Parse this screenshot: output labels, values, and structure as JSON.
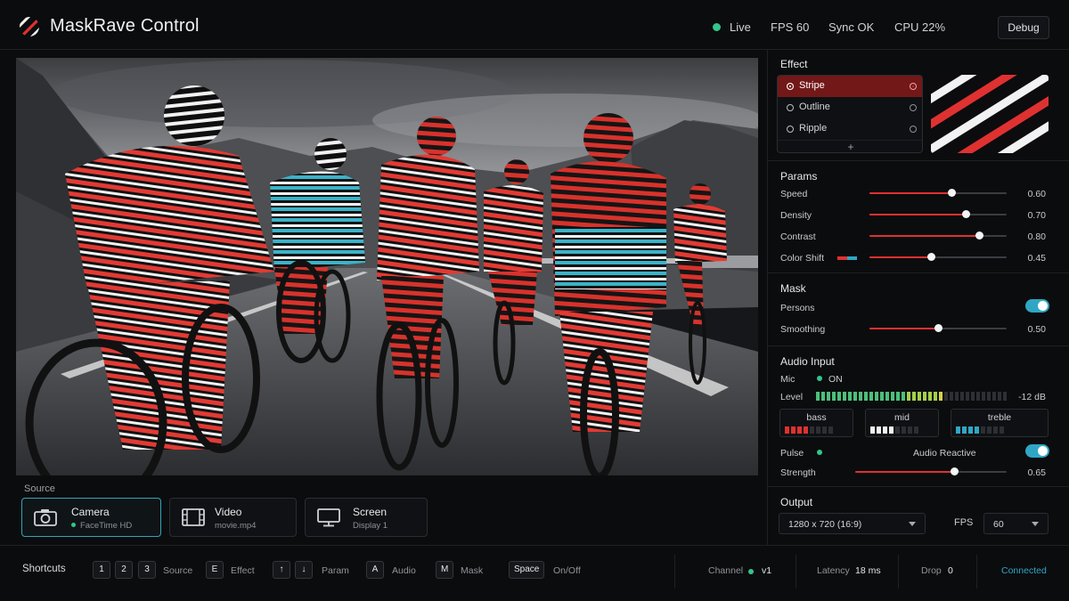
{
  "app": {
    "title": "MaskRave Control"
  },
  "header": {
    "live_label": "Live",
    "fps_label": "FPS 60",
    "sync_label": "Sync OK",
    "cpu_label": "CPU 22%",
    "debug_label": "Debug"
  },
  "source": {
    "label": "Source",
    "items": [
      {
        "title": "Camera",
        "subtitle": "FaceTime HD",
        "icon": "camera-icon",
        "active": true
      },
      {
        "title": "Video",
        "subtitle": "movie.mp4",
        "icon": "film-icon",
        "active": false
      },
      {
        "title": "Screen",
        "subtitle": "Display 1",
        "icon": "monitor-icon",
        "active": false
      }
    ]
  },
  "effect": {
    "title": "Effect",
    "items": [
      {
        "label": "Stripe",
        "selected": true
      },
      {
        "label": "Outline",
        "selected": false
      },
      {
        "label": "Ripple",
        "selected": false
      }
    ],
    "add_label": "+"
  },
  "params": {
    "title": "Params",
    "items": [
      {
        "label": "Speed",
        "value": 0.6,
        "display": "0.60"
      },
      {
        "label": "Density",
        "value": 0.7,
        "display": "0.70"
      },
      {
        "label": "Contrast",
        "value": 0.8,
        "display": "0.80"
      },
      {
        "label": "Color Shift",
        "value": 0.45,
        "display": "0.45"
      }
    ],
    "color_shift_swatch": [
      "#e03131",
      "#2fa7c4"
    ]
  },
  "mask": {
    "title": "Mask",
    "persons_label": "Persons",
    "persons_on": true,
    "smoothing_label": "Smoothing",
    "smoothing_value": 0.5,
    "smoothing_display": "0.50"
  },
  "audio": {
    "title": "Audio Input",
    "mic_label": "Mic",
    "mic_state": "ON",
    "level_label": "Level",
    "level_db": "-12 dB",
    "level_fraction": 0.68,
    "bands": [
      {
        "name": "bass",
        "active_bars": 4,
        "color": "#e03131"
      },
      {
        "name": "mid",
        "active_bars": 4,
        "color": "#f2f2f2"
      },
      {
        "name": "treble",
        "active_bars": 4,
        "color": "#2fa7c4"
      }
    ],
    "pulse_label": "Pulse",
    "reactive_label": "Audio Reactive",
    "reactive_on": true,
    "strength_label": "Strength",
    "strength_value": 0.65,
    "strength_display": "0.65"
  },
  "output": {
    "title": "Output",
    "resolution": "1280 x 720 (16:9)",
    "fps_label": "FPS",
    "fps_value": "60"
  },
  "footer": {
    "shortcuts_title": "Shortcuts",
    "keys": {
      "k1": "1",
      "k2": "2",
      "k3": "3",
      "source_label": "Source",
      "ke": "E",
      "effect_label": "Effect",
      "kup": "↑",
      "kdown": "↓",
      "param_label": "Param",
      "ka": "A",
      "audio_label": "Audio",
      "km": "M",
      "mask_label": "Mask",
      "kspace": "Space",
      "onoff_label": "On/Off"
    },
    "channel_label": "Channel",
    "channel_value": "v1",
    "latency_label": "Latency",
    "latency_value": "18 ms",
    "drop_label": "Drop",
    "drop_value": "0",
    "connection_status": "Connected"
  },
  "colors": {
    "accent_red": "#e03131",
    "accent_cyan": "#2fa7c4",
    "ok_green": "#34c58a"
  }
}
